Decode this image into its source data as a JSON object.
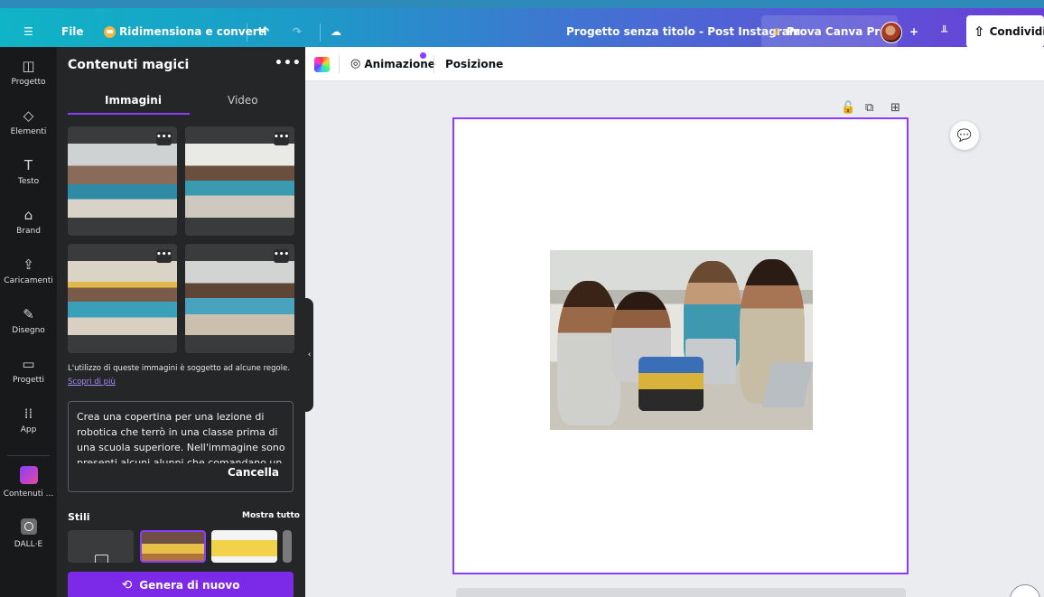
{
  "topbar": {
    "menu_icon": "☰",
    "file_label": "File",
    "resize_label": "Ridimensiona e converti",
    "undo_icon": "↶",
    "redo_icon": "↷",
    "cloud_icon": "☁",
    "project_title": "Progetto senza titolo - Post Instagram",
    "pro_label": "Prova Canva Pro",
    "pro_icon": "♛",
    "add_icon": "+",
    "stats_icon": "╨",
    "share_icon": "⇧",
    "share_label": "Condividi"
  },
  "rail": {
    "items": [
      {
        "icon": "◫",
        "label": "Progetto"
      },
      {
        "icon": "◇",
        "label": "Elementi"
      },
      {
        "icon": "T",
        "label": "Testo"
      },
      {
        "icon": "⌂",
        "label": "Brand"
      },
      {
        "icon": "⇪",
        "label": "Caricamenti"
      },
      {
        "icon": "✎",
        "label": "Disegno"
      },
      {
        "icon": "▭",
        "label": "Progetti"
      },
      {
        "icon": "⁞⁞",
        "label": "App"
      },
      {
        "icon": "",
        "label": "Contenuti ..."
      },
      {
        "icon": "",
        "label": "DALL·E"
      }
    ]
  },
  "panel": {
    "title": "Contenuti magici",
    "more_icon": "•••",
    "tabs": [
      {
        "label": "Immagini",
        "active": true
      },
      {
        "label": "Video",
        "active": false
      }
    ],
    "thumb_more": "•••",
    "notice": "L'utilizzo di queste immagini è soggetto ad alcune regole.",
    "notice_link": "Scopri di più",
    "prompt": "Crea una copertina per una lezione di robotica che terrò in una classe prima di una scuola superiore.  Nell'immagine sono presenti alcuni alunni che comandano un",
    "cancel_label": "Cancella",
    "styles_label": "Stili",
    "styles_all": "Mostra tutto",
    "generate_label": "Genera di nuovo",
    "generate_icon": "⟲",
    "collapse_icon": "‹"
  },
  "editor_toolbar": {
    "animation_label": "Animazione",
    "animation_icon": "◎",
    "position_label": "Posizione"
  },
  "canvas": {
    "lock_icon": "🔓",
    "duplicate_icon": "⧉",
    "add_page_icon": "⊞",
    "comment_icon": "💬"
  },
  "colors": {
    "accent": "#8b3dff",
    "generate_button": "#7d2ae8",
    "panel_bg": "#252627",
    "rail_bg": "#18191b"
  }
}
